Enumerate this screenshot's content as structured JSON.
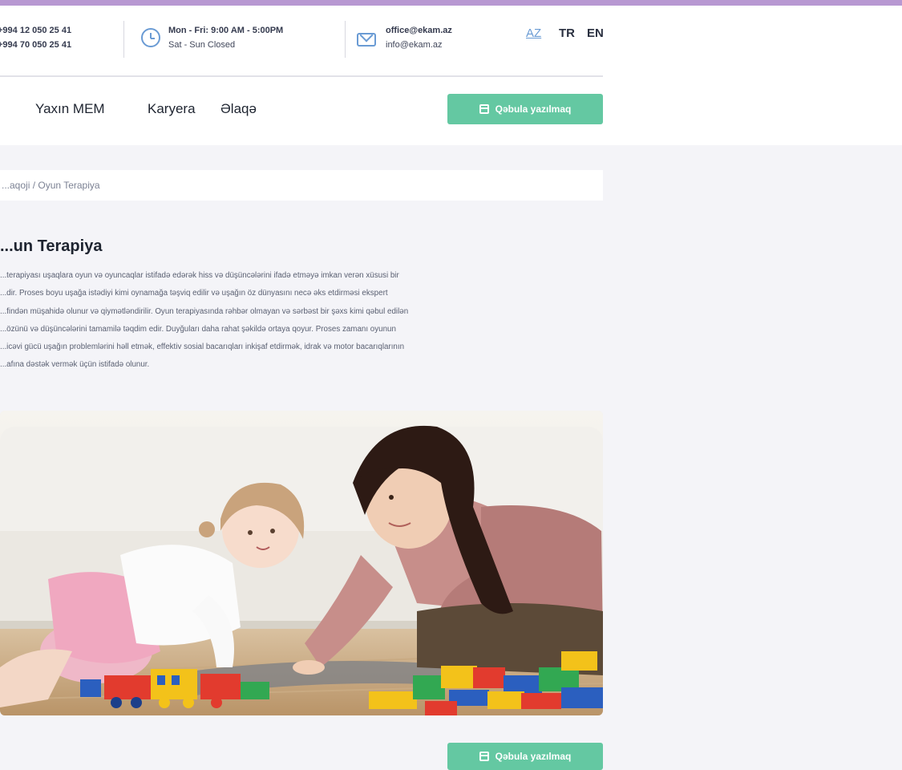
{
  "header": {
    "phones": [
      "+994 12 050 25 41",
      "+994 70 050 25 41"
    ],
    "hours": [
      "Mon - Fri: 9:00 AM - 5:00PM",
      "Sat - Sun Closed"
    ],
    "emails": [
      "office@ekam.az",
      "info@ekam.az"
    ],
    "languages": [
      "AZ",
      "TR",
      "EN"
    ],
    "active_language": "AZ"
  },
  "nav": {
    "items": [
      "Yaxın MEM",
      "Karyera",
      "Əlaqə"
    ],
    "cta_label": "Qəbula yazılmaq"
  },
  "breadcrumb": {
    "parent": "...aqoji",
    "separator": "/",
    "current": "Oyun Terapiya"
  },
  "page": {
    "title": "...un Terapiya",
    "paragraph_lines": [
      "...terapiyası uşaqlara oyun və oyuncaqlar istifadə edərək hiss və düşüncələrini ifadə etməyə imkan verən xüsusi bir",
      "...dir. Proses boyu uşağa istədiyi kimi oynamağa təşviq edilir və uşağın öz dünyasını necə əks etdirməsi ekspert",
      "...findən müşahidə olunur və qiymətləndirilir. Oyun terapiyasında rəhbər olmayan və sərbəst bir şəxs kimi qəbul edilən",
      "...özünü və düşüncələrini tamamilə təqdim edir. Duyğuları daha rahat şəkildə ortaya qoyur. Proses zamanı oyunun",
      "...icəvi gücü uşağın problemlərini həll etmək, effektiv sosial bacarıqları inkişaf etdirmək, idrak və motor bacarıqlarının",
      "...afına dəstək vermək üçün istifadə olunur."
    ],
    "bottom_cta_label": "Qəbula yazılmaq"
  },
  "colors": {
    "accent": "#64c8a2",
    "top_bar": "#b898d2",
    "icon_blue": "#6a9bd4"
  }
}
